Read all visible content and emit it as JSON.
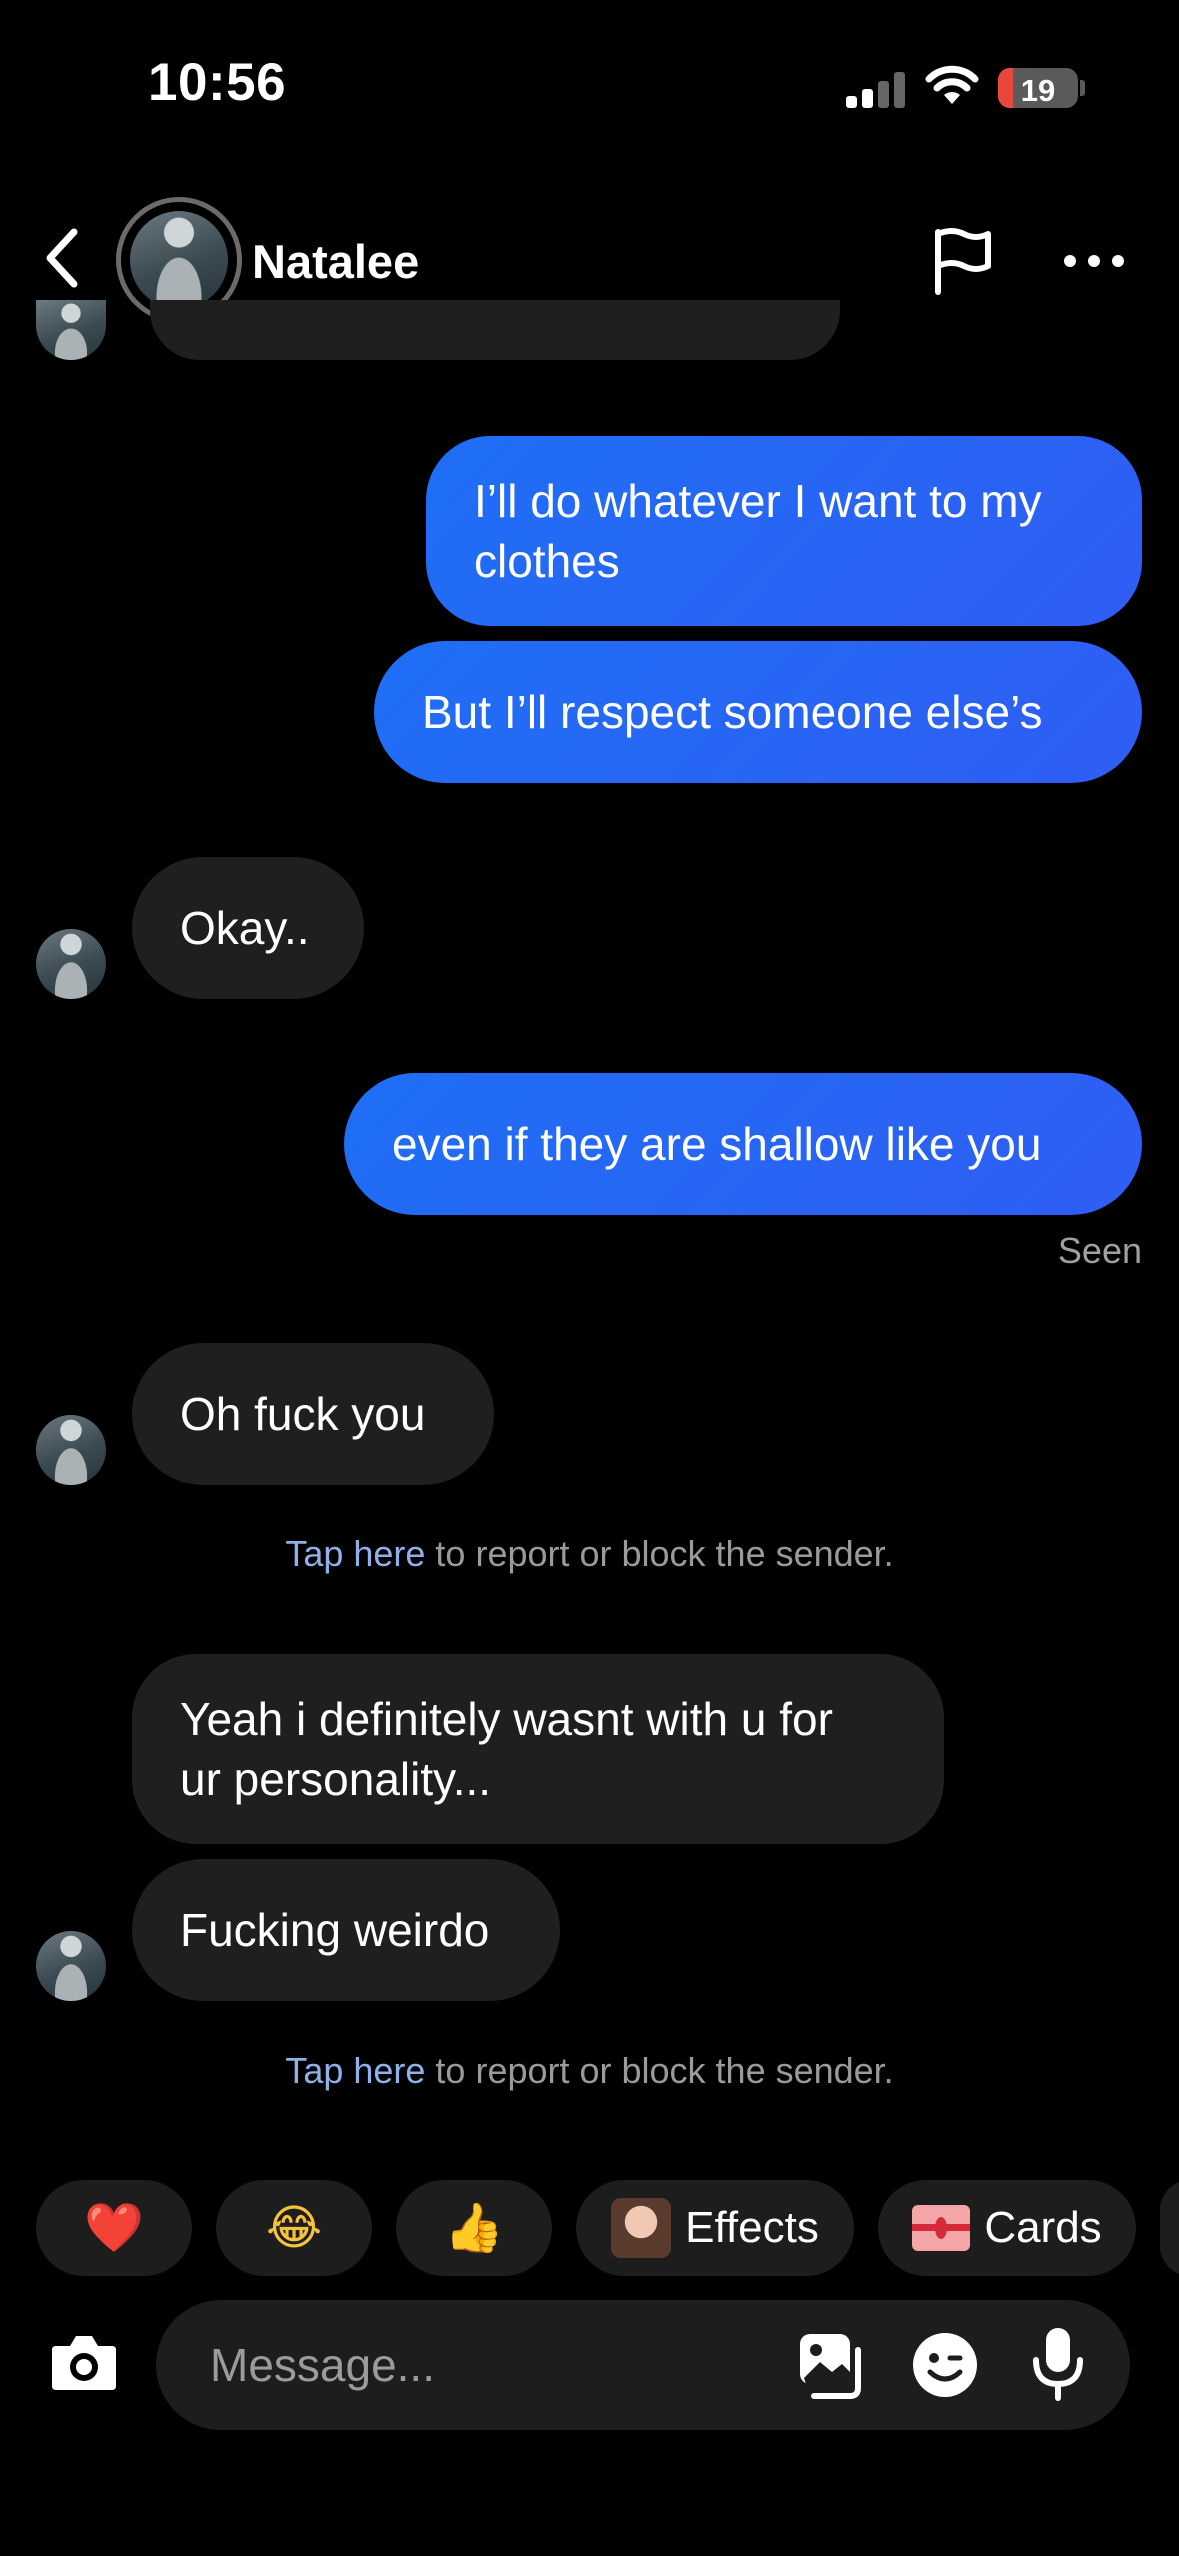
{
  "status_bar": {
    "time": "10:56",
    "battery": "19",
    "battery_level": 0.19
  },
  "header": {
    "contact_name": "Natalee"
  },
  "messages": [
    {
      "side": "out",
      "lines": [
        "I’ll do whatever I want to my",
        "clothes"
      ]
    },
    {
      "side": "out",
      "text": "But I’ll respect someone else’s"
    },
    {
      "side": "in",
      "text": "Okay.."
    },
    {
      "side": "out",
      "text": "even if they are shallow like you"
    },
    {
      "side": "in",
      "text": "Oh fuck you"
    },
    {
      "side": "in",
      "lines": [
        "Yeah i definitely wasnt with u for",
        "ur personality..."
      ]
    },
    {
      "side": "in",
      "text": "Fucking weirdo"
    }
  ],
  "seen_label": "Seen",
  "report_notices": [
    {
      "link": "Tap here",
      "rest": " to report or block the sender."
    },
    {
      "link": "Tap here",
      "rest": " to report or block the sender."
    }
  ],
  "reactions": [
    {
      "icon": "heart-icon",
      "glyph": "❤️"
    },
    {
      "icon": "laughing-emoji-icon",
      "glyph": "😂"
    },
    {
      "icon": "thumbs-up-icon",
      "glyph": "👍"
    },
    {
      "icon": "effects-icon",
      "label": "Effects"
    },
    {
      "icon": "cards-icon",
      "label": "Cards"
    }
  ],
  "composer": {
    "placeholder": "Message..."
  },
  "colors": {
    "outgoing_bubble": "#2563f5",
    "incoming_bubble": "#1f1f1f",
    "link": "#8fb0e8"
  }
}
